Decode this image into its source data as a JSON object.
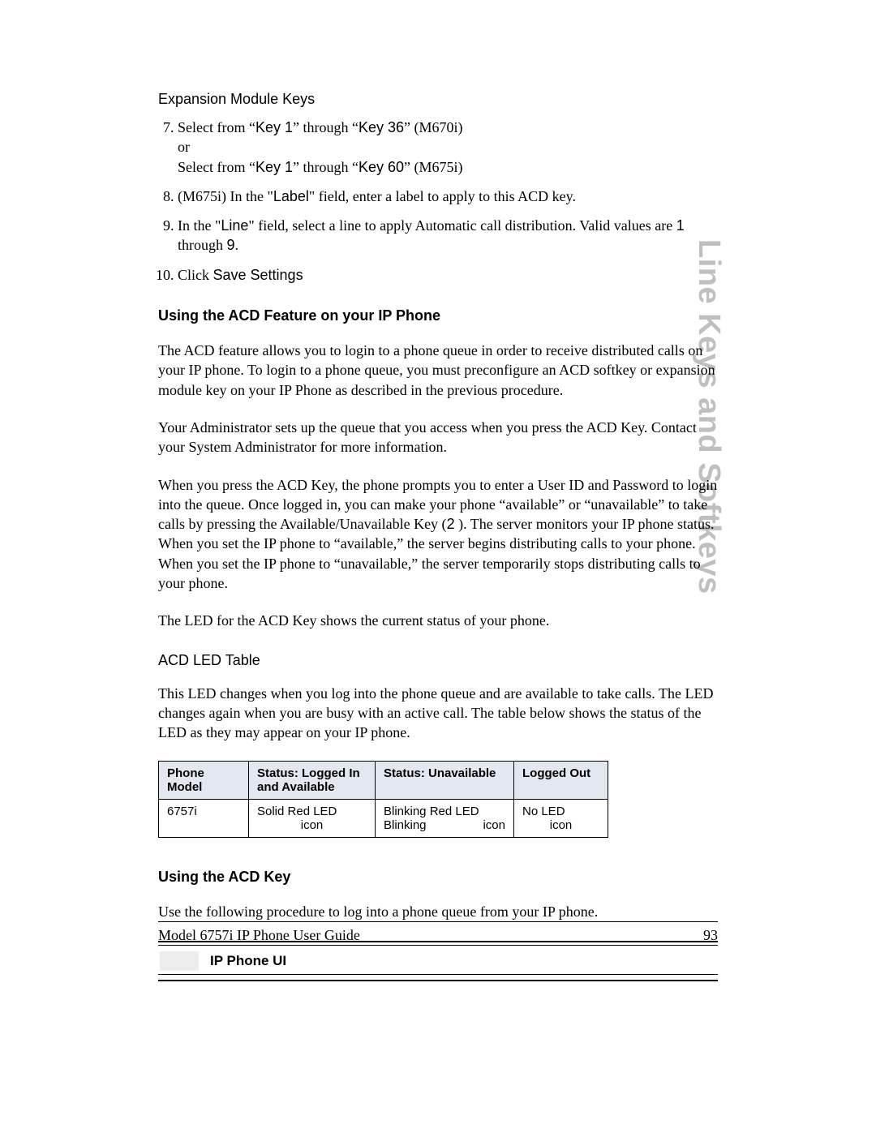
{
  "sideTitle": "Line Keys and Softkeys",
  "header": {
    "sectionTitle": "Expansion Module Keys"
  },
  "list": {
    "start": 7,
    "items": [
      {
        "pre1": "Select from “",
        "key1": "Key 1",
        "mid1": "” through “",
        "key36": "Key 36",
        "post1": "” (M670i)",
        "or": "or",
        "pre2": "Select from “",
        "key1b": "Key 1",
        "mid2": "” through “",
        "key60": "Key 60",
        "post2": "” (M675i)"
      },
      {
        "pre": "(M675i) In the \"",
        "label": "Label",
        "post": "\" field, enter a label to apply to this ACD key."
      },
      {
        "pre": "In the \"",
        "line": "Line",
        "mid": "\" field, select a line to apply Automatic call distribution. Valid values are ",
        "one": "1",
        "through": " through ",
        "nine": "9",
        "period": "."
      },
      {
        "pre": "Click ",
        "save": "Save Settings"
      }
    ]
  },
  "subheading1": "Using the ACD Feature on your IP Phone",
  "para1": "The ACD feature allows you to login to a phone queue in order to receive distributed calls on your IP phone. To login to a phone queue, you must preconfigure an ACD softkey or expansion module key on your IP Phone as described in the previous procedure.",
  "para2": "Your Administrator sets up the queue that you access when you press the ACD Key. Contact your System Administrator for more information.",
  "para3a": "When you press the ACD Key, the phone prompts you to enter a User ID and Password to login into the queue. Once logged in, you can make your phone “available” or “unavailable” to take calls by pressing the Available/Unavailable Key (",
  "para3key": "2",
  "para3b": " ). The server monitors your IP phone status. When you set the IP phone to “available,” the server begins distributing calls to your phone. When you set the IP phone to “unavailable,” the server temporarily stops distributing calls to your phone.",
  "para4": "The LED for the ACD Key shows the current status of your phone.",
  "subhead2": "ACD LED Table",
  "para5": "This LED changes when you log into the phone queue and are available to take calls. The LED changes again when you are busy with an active call. The table below shows the status of the LED as they may appear on your IP phone.",
  "table": {
    "headers": [
      "Phone Model",
      "Status: Logged In and Available",
      "Status: Unavailable",
      "Logged Out"
    ],
    "row": {
      "model": "6757i",
      "c1a": "Solid Red LED",
      "c1b": "icon",
      "c2a": "Blinking Red LED",
      "c2b1": "Blinking",
      "c2b2": "icon",
      "c3a": "No LED",
      "c3b": "icon"
    }
  },
  "subheading3": "Using the ACD Key",
  "para6": "Use the following procedure to log into a phone queue from your IP phone.",
  "uiLabel": "IP Phone UI",
  "footer": {
    "left": "Model 6757i IP Phone User Guide",
    "right": "93"
  }
}
